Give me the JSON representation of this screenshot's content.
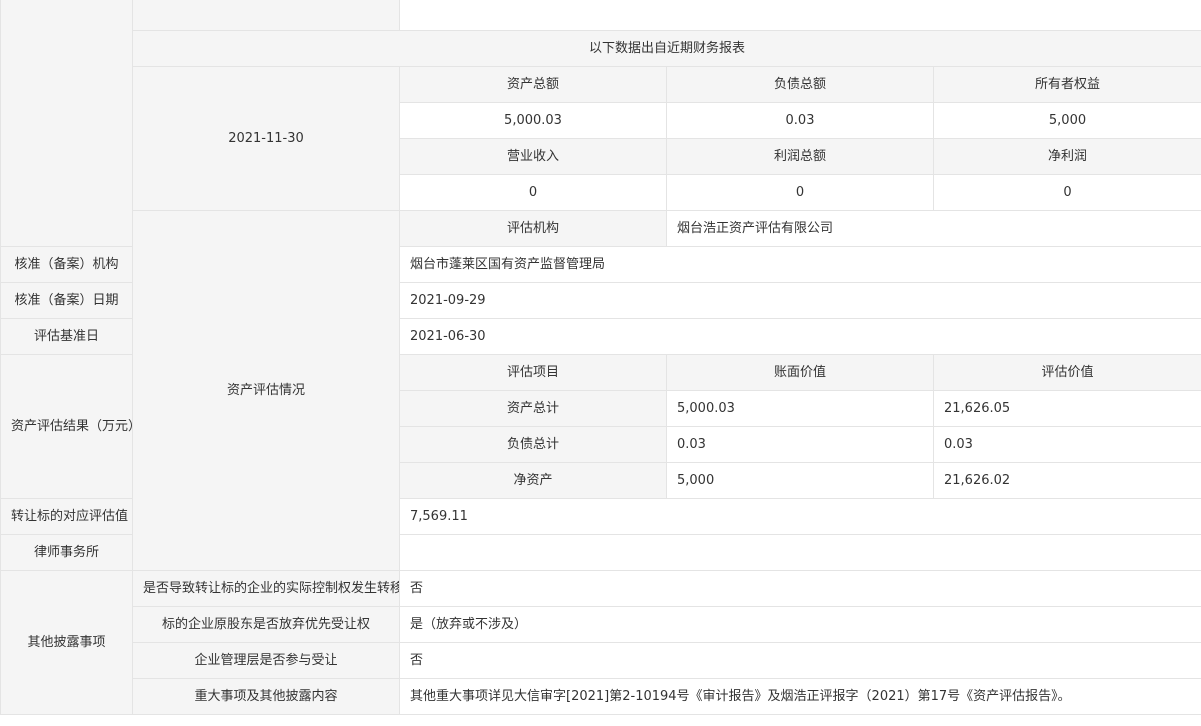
{
  "financial": {
    "banner": "以下数据出自近期财务报表",
    "date": "2021-11-30",
    "headers1": [
      "资产总额",
      "负债总额",
      "所有者权益"
    ],
    "values1": [
      "5,000.03",
      "0.03",
      "5,000"
    ],
    "headers2": [
      "营业收入",
      "利润总额",
      "净利润"
    ],
    "values2": [
      "0",
      "0",
      "0"
    ]
  },
  "asset_evaluation": {
    "section_label": "资产评估情况",
    "org_label": "评估机构",
    "org_value": "烟台浩正资产评估有限公司",
    "approval_org_label": "核准（备案）机构",
    "approval_org_value": "烟台市蓬莱区国有资产监督管理局",
    "approval_date_label": "核准（备案）日期",
    "approval_date_value": "2021-09-29",
    "base_date_label": "评估基准日",
    "base_date_value": "2021-06-30",
    "result_label": "资产评估结果（万元）",
    "result_headers": [
      "评估项目",
      "账面价值",
      "评估价值"
    ],
    "result_rows": [
      [
        "资产总计",
        "5,000.03",
        "21,626.05"
      ],
      [
        "负债总计",
        "0.03",
        "0.03"
      ],
      [
        "净资产",
        "5,000",
        "21,626.02"
      ]
    ],
    "transfer_value_label": "转让标的对应评估值（万元）",
    "transfer_value": "7,569.11",
    "law_firm_label": "律师事务所",
    "law_firm_value": ""
  },
  "other_disclosure": {
    "section_label": "其他披露事项",
    "control_change_label": "是否导致转让标的企业的实际控制权发生转移",
    "control_change_value": "否",
    "preemptive_label": "标的企业原股东是否放弃优先受让权",
    "preemptive_value": "是（放弃或不涉及）",
    "management_label": "企业管理层是否参与受让",
    "management_value": "否",
    "major_label": "重大事项及其他披露内容",
    "major_value": "其他重大事项详见大信审字[2021]第2-10194号《审计报告》及烟浩正评报字（2021）第17号《资产评估报告》。"
  }
}
